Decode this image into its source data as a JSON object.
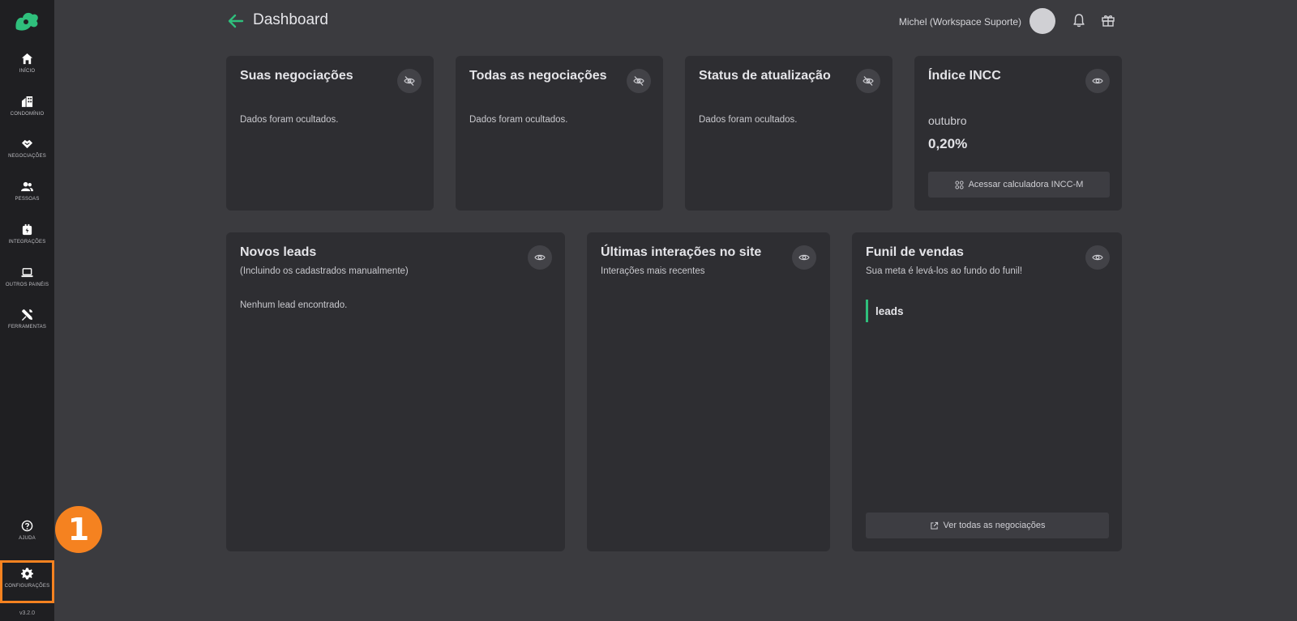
{
  "sidebar": {
    "items": [
      {
        "label": "Início",
        "icon": "home-icon"
      },
      {
        "label": "Condomínio",
        "icon": "building-icon"
      },
      {
        "label": "Negociações",
        "icon": "handshake-icon"
      },
      {
        "label": "Pessoas",
        "icon": "people-icon"
      },
      {
        "label": "Integrações",
        "icon": "plug-icon"
      },
      {
        "label": "Outros painéis",
        "icon": "laptop-icon"
      },
      {
        "label": "Ferramentas",
        "icon": "tools-icon"
      }
    ],
    "help_label": "Ajuda",
    "settings_label": "Configurações",
    "version": "v3.2.0"
  },
  "annotation": {
    "step": "1",
    "color": "#f58220"
  },
  "header": {
    "title": "Dashboard",
    "user": "Michel (Workspace Suporte)"
  },
  "cards": {
    "suas_negociacoes": {
      "title": "Suas negociações",
      "message": "Dados foram ocultados."
    },
    "todas_negociacoes": {
      "title": "Todas as negociações",
      "message": "Dados foram ocultados."
    },
    "status_atualizacao": {
      "title": "Status de atualização",
      "message": "Dados foram ocultados."
    },
    "indice_incc": {
      "title": "Índice INCC",
      "month": "outubro",
      "value": "0,20%",
      "button_label": "Acessar calculadora INCC-M"
    },
    "novos_leads": {
      "title": "Novos leads",
      "subtitle": "(Incluindo os cadastrados manualmente)",
      "message": "Nenhum lead encontrado."
    },
    "ultimas_interacoes": {
      "title": "Últimas interações no site",
      "subtitle": "Interações mais recentes"
    },
    "funil_vendas": {
      "title": "Funil de vendas",
      "subtitle": "Sua meta é levá-los ao fundo do funil!",
      "stage_label": "leads",
      "button_label": "Ver todas as negociações"
    }
  },
  "colors": {
    "accent": "#2fbf7c",
    "highlight": "#f58220"
  }
}
